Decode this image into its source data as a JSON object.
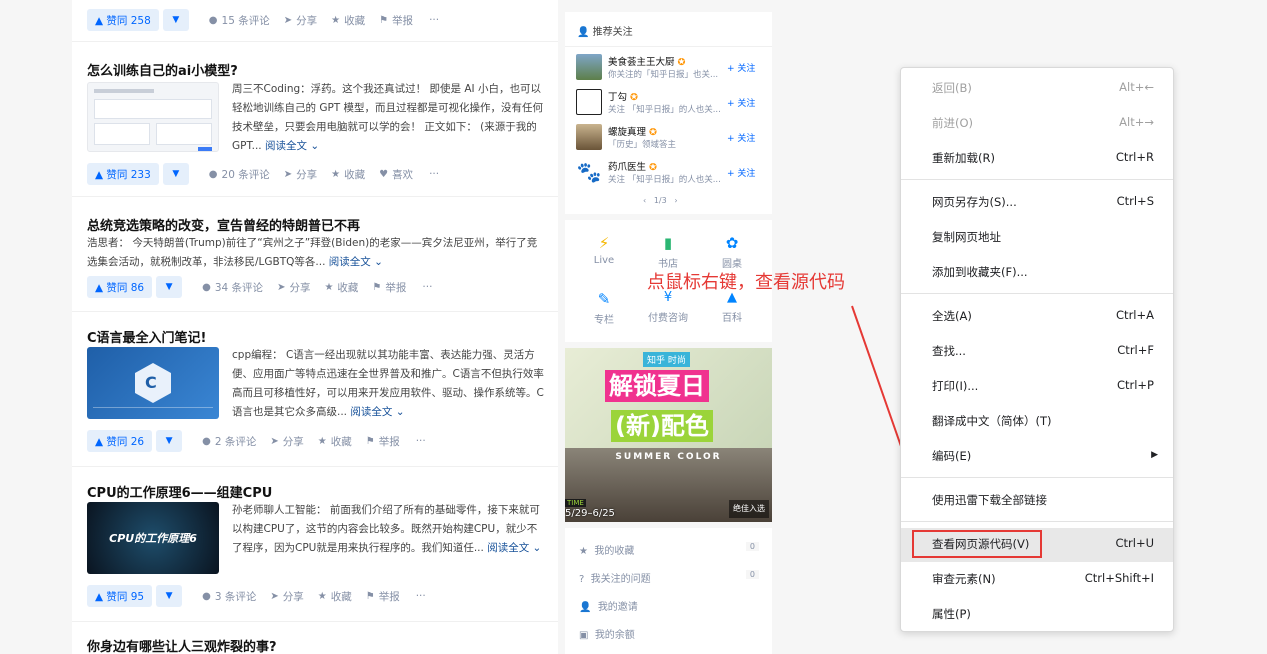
{
  "feed": {
    "card0": {
      "vote": "▲ 赞同 258",
      "comments": "15 条评论",
      "share": "分享",
      "fav": "收藏",
      "report": "举报",
      "more": "···"
    },
    "card1": {
      "title": "怎么训练自己的ai小模型?",
      "lines": [
        "周三不Coding：浮药。这个我还真试过！ 即使是 AI 小白，也可以",
        "轻松地训练自己的 GPT 模型，而且过程都是可视化操作，没有任何",
        "技术壁垒，只要会用电脑就可以学的会！ 正文如下： (来源于我的"
      ],
      "last": "GPT...",
      "more_link": "阅读全文",
      "vote": "▲ 赞同 233",
      "comments": "20 条评论",
      "share": "分享",
      "fav": "收藏",
      "like": "喜欢",
      "more": "···"
    },
    "card2": {
      "title": "总统竞选策略的改变，宣告曾经的特朗普已不再",
      "lines": [
        "浩思者： 今天特朗普(Trump)前往了“宾州之子”拜登(Biden)的老家——宾夕法尼亚州，举行了竞"
      ],
      "last": "选集会活动，就税制改革，非法移民/LGBTQ等各...",
      "more_link": "阅读全文",
      "vote": "▲ 赞同 86",
      "comments": "34 条评论",
      "share": "分享",
      "fav": "收藏",
      "report": "举报",
      "more": "···"
    },
    "card3": {
      "title": "C语言最全入门笔记!",
      "lines": [
        "cpp编程： C语言一经出现就以其功能丰富、表达能力强、灵活方",
        "便、应用面广等特点迅速在全世界普及和推广。C语言不但执行效率",
        "高而且可移植性好，可以用来开发应用软件、驱动、操作系统等。C"
      ],
      "last": "语言也是其它众多高级...",
      "more_link": "阅读全文",
      "vote": "▲ 赞同 26",
      "comments": "2 条评论",
      "share": "分享",
      "fav": "收藏",
      "report": "举报",
      "more": "···"
    },
    "card4": {
      "title": "CPU的工作原理6——组建CPU",
      "thumb_text": "CPU的工作原理6",
      "lines": [
        "孙老师聊人工智能： 前面我们介绍了所有的基础零件，接下来就可",
        "以构建CPU了，这节的内容会比较多。既然开始构建CPU，就少不"
      ],
      "last": "了程序，因为CPU就是用来执行程序的。我们知道任...",
      "more_link": "阅读全文",
      "vote": "▲ 赞同 95",
      "comments": "3 条评论",
      "share": "分享",
      "fav": "收藏",
      "report": "举报",
      "more": "···"
    },
    "card5": {
      "title": "你身边有哪些让人三观炸裂的事?"
    }
  },
  "sidebar": {
    "recommend_title": "推荐关注",
    "users": [
      {
        "name": "美食荟主王大厨",
        "desc": "你关注的「知乎日报」也关...",
        "follow": "+ 关注"
      },
      {
        "name": "丁勾",
        "desc": "关注 「知乎日报」的人也关...",
        "follow": "+ 关注"
      },
      {
        "name": "螺旋真理",
        "desc": "「历史」领域答主",
        "follow": "+ 关注"
      },
      {
        "name": "药爪医生",
        "desc": "关注 「知乎日报」的人也关...",
        "follow": "+ 关注"
      }
    ],
    "pager": "1/3",
    "tiles": [
      {
        "label": "Live",
        "icon": "⚡"
      },
      {
        "label": "书店",
        "icon": "▮"
      },
      {
        "label": "圆桌",
        "icon": "✿"
      },
      {
        "label": "专栏",
        "icon": "✎"
      },
      {
        "label": "付费咨询",
        "icon": "¥"
      },
      {
        "label": "百科",
        "icon": "▲"
      }
    ],
    "banner": {
      "brand": "知乎 时尚",
      "headline1": "解锁夏日",
      "headline2": "(新)配色",
      "sub": "SUMMER COLOR",
      "date": "5/29–6/25",
      "time_tag": "TIME",
      "corner": "绝佳入选"
    },
    "links": [
      {
        "label": "我的收藏",
        "count": "0"
      },
      {
        "label": "我关注的问题",
        "count": "0"
      },
      {
        "label": "我的邀请",
        "count": ""
      },
      {
        "label": "我的余额",
        "count": ""
      }
    ]
  },
  "annotation": "点鼠标右键，查看源代码",
  "context_menu": {
    "back": {
      "label": "返回(B)",
      "shortcut": "Alt+←"
    },
    "forward": {
      "label": "前进(O)",
      "shortcut": "Alt+→"
    },
    "reload": {
      "label": "重新加载(R)",
      "shortcut": "Ctrl+R"
    },
    "save_as": {
      "label": "网页另存为(S)...",
      "shortcut": "Ctrl+S"
    },
    "copy_url": {
      "label": "复制网页地址",
      "shortcut": ""
    },
    "add_fav": {
      "label": "添加到收藏夹(F)...",
      "shortcut": ""
    },
    "select_all": {
      "label": "全选(A)",
      "shortcut": "Ctrl+A"
    },
    "find": {
      "label": "查找...",
      "shortcut": "Ctrl+F"
    },
    "print": {
      "label": "打印(I)...",
      "shortcut": "Ctrl+P"
    },
    "translate": {
      "label": "翻译成中文（简体）(T)",
      "shortcut": ""
    },
    "encoding": {
      "label": "编码(E)",
      "shortcut": "▶"
    },
    "xunlei": {
      "label": "使用迅雷下载全部链接",
      "shortcut": ""
    },
    "view_source": {
      "label": "查看网页源代码(V)",
      "shortcut": "Ctrl+U"
    },
    "inspect": {
      "label": "审查元素(N)",
      "shortcut": "Ctrl+Shift+I"
    },
    "properties": {
      "label": "属性(P)",
      "shortcut": ""
    }
  }
}
